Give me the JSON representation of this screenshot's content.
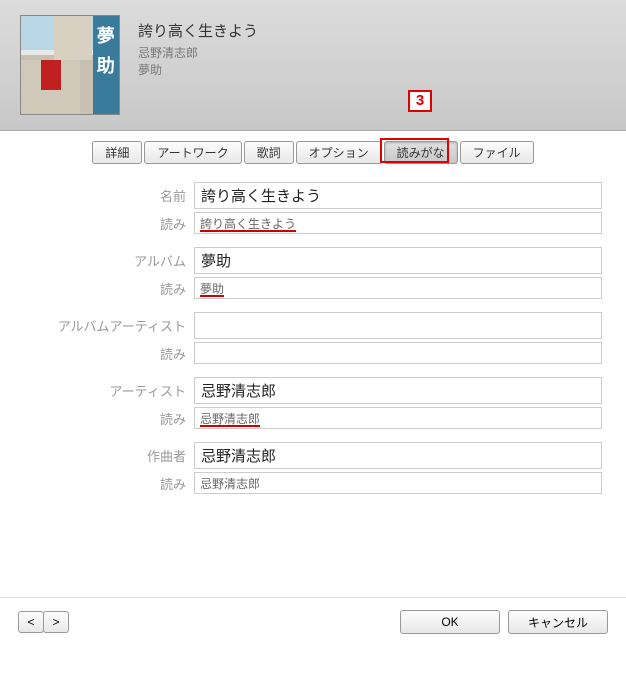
{
  "header": {
    "title": "誇り高く生きよう",
    "artist": "忌野清志郎",
    "album": "夢助",
    "artwork_kanji_1": "夢",
    "artwork_kanji_2": "助"
  },
  "callout": {
    "label": "3"
  },
  "tabs": [
    {
      "label": "詳細"
    },
    {
      "label": "アートワーク"
    },
    {
      "label": "歌詞"
    },
    {
      "label": "オプション"
    },
    {
      "label": "読みがな",
      "active": true
    },
    {
      "label": "ファイル"
    }
  ],
  "fields": {
    "name_label": "名前",
    "name_value": "誇り高く生きよう",
    "name_yomi_label": "読み",
    "name_yomi_value": "誇り高く生きよう",
    "album_label": "アルバム",
    "album_value": "夢助",
    "album_yomi_label": "読み",
    "album_yomi_value": "夢助",
    "albumartist_label": "アルバムアーティスト",
    "albumartist_value": "",
    "albumartist_yomi_label": "読み",
    "albumartist_yomi_value": "",
    "artist_label": "アーティスト",
    "artist_value": "忌野清志郎",
    "artist_yomi_label": "読み",
    "artist_yomi_value": "忌野清志郎",
    "composer_label": "作曲者",
    "composer_value": "忌野清志郎",
    "composer_yomi_label": "読み",
    "composer_yomi_value": "忌野清志郎"
  },
  "footer": {
    "prev": "<",
    "next": ">",
    "ok": "OK",
    "cancel": "キャンセル"
  }
}
